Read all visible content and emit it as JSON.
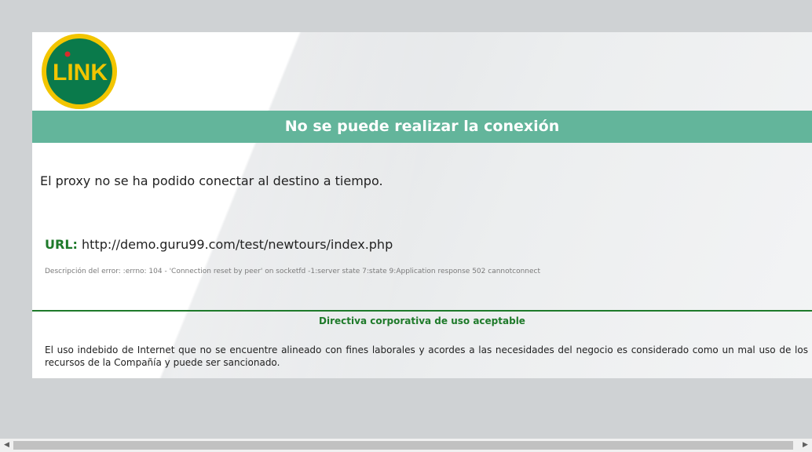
{
  "logo": {
    "text": "LINK",
    "colors": {
      "ring": "#f2c500",
      "disc": "#0a7a4b",
      "letters": "#f2c500",
      "dot": "#d92b2b"
    }
  },
  "header": {
    "title": "No se puede realizar la conexión"
  },
  "main": {
    "message": "El proxy no se ha podido conectar al destino a tiempo.",
    "url_label": "URL:",
    "url_value": "http://demo.guru99.com/test/newtours/index.php",
    "error_description": "Descripción del error: :errno: 104 - 'Connection reset by peer' on socketfd -1:server state 7:state 9:Application response 502 cannotconnect"
  },
  "policy": {
    "title": "Directiva corporativa de uso aceptable",
    "text": "El uso indebido de Internet que no se encuentre alineado con fines laborales y acordes a las necesidades del negocio es considerado como un mal uso de los recursos de la Compañía y puede ser sancionado."
  },
  "scrollbar": {
    "left_arrow": "◀",
    "right_arrow": "▶"
  },
  "colors": {
    "title_bar": "#63b59b",
    "accent_green": "#1e7a2a",
    "page_background": "#cfd2d4"
  }
}
